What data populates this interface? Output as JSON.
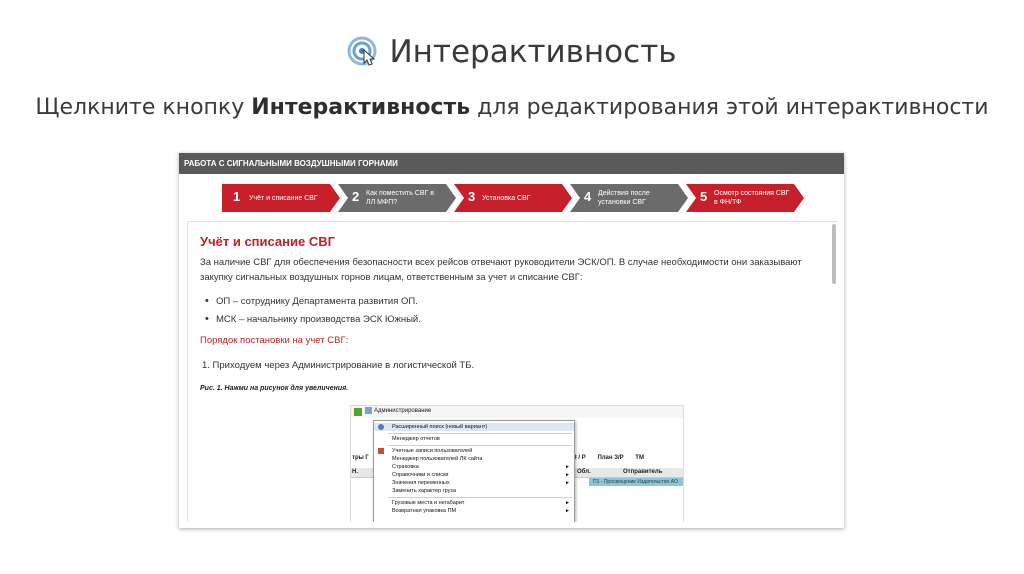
{
  "slide": {
    "title": "Интерактивность",
    "subtitle_pre": "Щелкните кнопку ",
    "subtitle_bold": "Интерактивность",
    "subtitle_post": " для редактирования этой интерактивности"
  },
  "frame": {
    "header": "РАБОТА С СИГНАЛЬНЫМИ ВОЗДУШНЫМИ ГОРНАМИ",
    "steps": [
      {
        "num": "1",
        "label": "Учёт и списание СВГ",
        "active": true
      },
      {
        "num": "2",
        "label": "Как поместить СВГ в ЛЛ МФП?",
        "active": false
      },
      {
        "num": "3",
        "label": "Установка СВГ",
        "active": true
      },
      {
        "num": "4",
        "label": "Действия после установки СВГ",
        "active": false
      },
      {
        "num": "5",
        "label": "Осмотр состояния СВГ в ФН/ТФ",
        "active": true
      }
    ],
    "content": {
      "title": "Учёт и списание СВГ",
      "paragraph": "За наличие СВГ для обеспечения безопасности всех рейсов отвечают руководители ЭСК/ОП. В случае необходимости они заказывают закупку сигнальных воздушных горнов лицам, ответственным за учет и списание СВГ:",
      "bullets": [
        "ОП – сотруднику Департамента развития ОП.",
        "МСК – начальнику производства ЭСК Южный."
      ],
      "order_heading": "Порядок постановки на учет СВГ:",
      "step_1": "1. Приходуем через Администрирование в логистической ТБ.",
      "figure_caption": "Рис. 1. Нажми на рисунок для увеличения."
    }
  },
  "screenshot": {
    "toolbar_button": "Администрирование",
    "right_toolbar": [
      "З / Р",
      "План З/Р",
      "ТМ"
    ],
    "left_label": "тры Г",
    "left_n": "Н.",
    "grid_headers": [
      "Обл.",
      "Отправитель"
    ],
    "grid_row": "П1 - Просвещение Издательство АО",
    "menu_items": [
      {
        "label": "Расширенный поиск (новый вариант)",
        "highlight": true,
        "submenu": false,
        "icon": "search"
      },
      {
        "label": "Менеджер отчетов",
        "highlight": false,
        "submenu": false,
        "icon": ""
      },
      {
        "label": "Учетные записи пользователей",
        "highlight": false,
        "submenu": false,
        "icon": "users"
      },
      {
        "label": "Менеджер пользователей ЛК сайта",
        "highlight": false,
        "submenu": false,
        "icon": ""
      },
      {
        "label": "Страховка",
        "highlight": false,
        "submenu": true,
        "icon": ""
      },
      {
        "label": "Справочники и списки",
        "highlight": false,
        "submenu": true,
        "icon": ""
      },
      {
        "label": "Значения переменных",
        "highlight": false,
        "submenu": true,
        "icon": ""
      },
      {
        "label": "Заменить характер груза",
        "highlight": false,
        "submenu": false,
        "icon": ""
      },
      {
        "label": "Грузовые места и негабарит",
        "highlight": false,
        "submenu": true,
        "icon": ""
      },
      {
        "label": "Возвратная упаковка ПМ",
        "highlight": false,
        "submenu": true,
        "icon": ""
      }
    ],
    "submenu_glyph": "►"
  },
  "colors": {
    "accent_red": "#c0202a",
    "step_active": "#c8202a",
    "step_inactive": "#6b6b6b",
    "header_gray": "#595959"
  }
}
